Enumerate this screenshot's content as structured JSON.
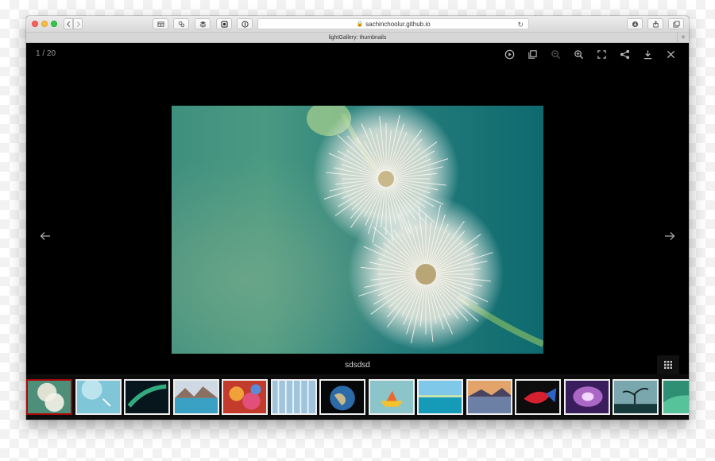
{
  "browser": {
    "url": "sachinchoolur.github.io",
    "tab_title": "lightGallery: thumbnails",
    "new_tab_label": "+"
  },
  "gallery": {
    "counter": "1 / 20",
    "caption": "sdsdsd",
    "toolbar_icons": [
      "play-icon",
      "fullscreen-thumbs-icon",
      "zoom-out-icon",
      "zoom-in-icon",
      "expand-icon",
      "share-icon",
      "download-icon",
      "close-icon"
    ],
    "thumbnails": [
      "dandelion",
      "feather-sky",
      "aurora",
      "mountain-lake",
      "coral-colors",
      "icicles",
      "earth",
      "paper-boat",
      "lagoon",
      "sunset-lake",
      "betta-fish",
      "purple-galaxy",
      "tree-silhouette",
      "green-wave"
    ],
    "active_thumbnail": 0
  }
}
